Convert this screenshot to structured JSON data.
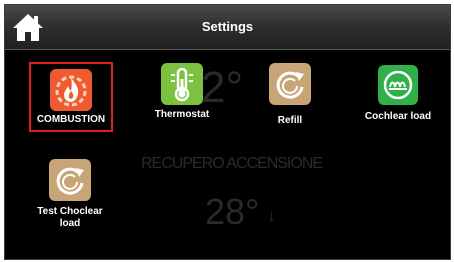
{
  "header": {
    "title": "Settings",
    "home_icon": "home-icon"
  },
  "background": {
    "temperature_top": "2°",
    "status_text": "RECUPERO ACCENSIONE",
    "temperature_bottom": "28°",
    "arrow": "↓"
  },
  "tiles": [
    {
      "label": "COMBUSTION",
      "icon": "flame-gear-icon",
      "color": "#ef5a2e",
      "selected": true
    },
    {
      "label": "Thermostat",
      "icon": "thermometer-icon",
      "color": "#7cc242",
      "selected": false
    },
    {
      "label": "Refill",
      "icon": "refill-cycle-icon",
      "color": "#c8a577",
      "selected": false
    },
    {
      "label": "Cochlear load",
      "icon": "auger-icon",
      "color": "#2fb04a",
      "selected": false
    },
    {
      "label": "Test Choclear load",
      "label_line1": "Test Choclear",
      "label_line2": "load",
      "icon": "refill-cycle-icon",
      "color": "#c8a577",
      "selected": false
    }
  ],
  "colors": {
    "selection_border": "#e0201c",
    "screen_background": "#000000",
    "header_background": "#333333"
  }
}
